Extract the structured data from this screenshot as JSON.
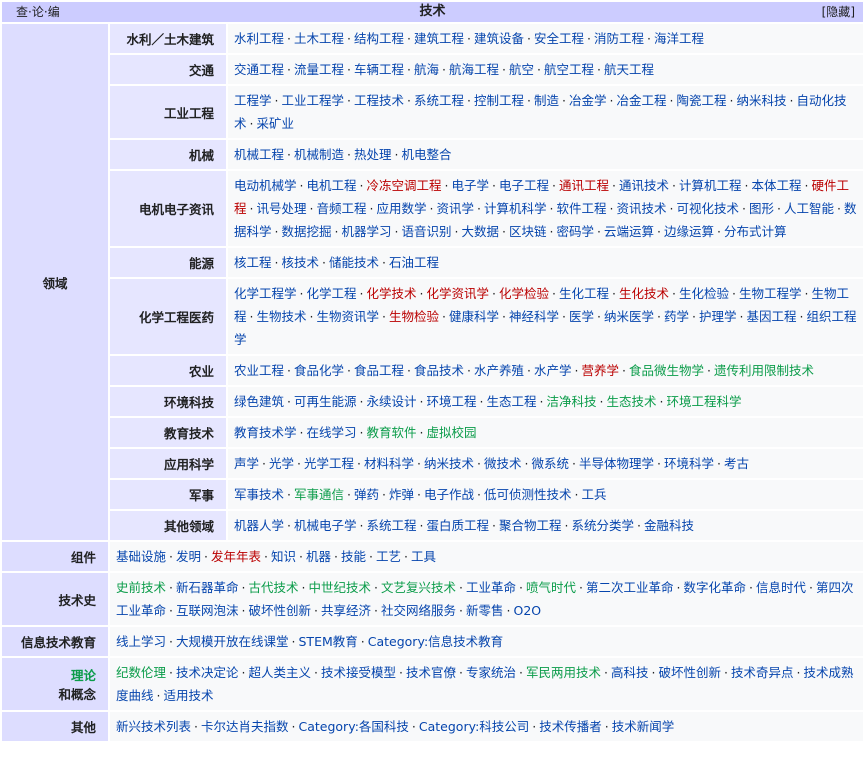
{
  "header": {
    "title": "技术",
    "vte": [
      "查",
      "论",
      "编"
    ],
    "hide": "隐藏"
  },
  "domains": {
    "label": "领域",
    "rows": [
      {
        "label": "水利／土木建筑",
        "items": [
          {
            "t": "水利工程"
          },
          {
            "t": "土木工程"
          },
          {
            "t": "结构工程"
          },
          {
            "t": "建筑工程"
          },
          {
            "t": "建筑设备"
          },
          {
            "t": "安全工程"
          },
          {
            "t": "消防工程"
          },
          {
            "t": "海洋工程"
          }
        ]
      },
      {
        "label": "交通",
        "items": [
          {
            "t": "交通工程"
          },
          {
            "t": "流量工程"
          },
          {
            "t": "车辆工程"
          },
          {
            "t": "航海"
          },
          {
            "t": "航海工程"
          },
          {
            "t": "航空"
          },
          {
            "t": "航空工程"
          },
          {
            "t": "航天工程"
          }
        ]
      },
      {
        "label": "工业工程",
        "items": [
          {
            "t": "工程学"
          },
          {
            "t": "工业工程学"
          },
          {
            "t": "工程技术"
          },
          {
            "t": "系统工程"
          },
          {
            "t": "控制工程"
          },
          {
            "t": "制造"
          },
          {
            "t": "冶金学"
          },
          {
            "t": "冶金工程"
          },
          {
            "t": "陶瓷工程"
          },
          {
            "t": "纳米科技"
          },
          {
            "t": "自动化技术"
          },
          {
            "t": "采矿业"
          }
        ]
      },
      {
        "label": "机械",
        "items": [
          {
            "t": "机械工程"
          },
          {
            "t": "机械制造"
          },
          {
            "t": "热处理"
          },
          {
            "t": "机电整合"
          }
        ]
      },
      {
        "label": "电机电子资讯",
        "items": [
          {
            "t": "电动机械学"
          },
          {
            "t": "电机工程"
          },
          {
            "t": "冷冻空调工程",
            "c": "red"
          },
          {
            "t": "电子学"
          },
          {
            "t": "电子工程"
          },
          {
            "t": "通讯工程",
            "c": "red"
          },
          {
            "t": "通讯技术"
          },
          {
            "t": "计算机工程"
          },
          {
            "t": "本体工程"
          },
          {
            "t": "硬件工程",
            "c": "red"
          },
          {
            "t": "讯号处理"
          },
          {
            "t": "音频工程"
          },
          {
            "t": "应用数学"
          },
          {
            "t": "资讯学"
          },
          {
            "t": "计算机科学"
          },
          {
            "t": "软件工程"
          },
          {
            "t": "资讯技术"
          },
          {
            "t": "可视化技术"
          },
          {
            "t": "图形"
          },
          {
            "t": "人工智能"
          },
          {
            "t": "数据科学"
          },
          {
            "t": "数据挖掘"
          },
          {
            "t": "机器学习"
          },
          {
            "t": "语音识别"
          },
          {
            "t": "大数据"
          },
          {
            "t": "区块链"
          },
          {
            "t": "密码学"
          },
          {
            "t": "云端运算"
          },
          {
            "t": "边缘运算"
          },
          {
            "t": "分布式计算"
          }
        ]
      },
      {
        "label": "能源",
        "items": [
          {
            "t": "核工程"
          },
          {
            "t": "核技术"
          },
          {
            "t": "储能技术"
          },
          {
            "t": "石油工程"
          }
        ]
      },
      {
        "label": "化学工程医药",
        "items": [
          {
            "t": "化学工程学"
          },
          {
            "t": "化学工程"
          },
          {
            "t": "化学技术",
            "c": "red"
          },
          {
            "t": "化学资讯学",
            "c": "red"
          },
          {
            "t": "化学检验",
            "c": "red"
          },
          {
            "t": "生化工程"
          },
          {
            "t": "生化技术",
            "c": "red"
          },
          {
            "t": "生化检验"
          },
          {
            "t": "生物工程学"
          },
          {
            "t": "生物工程"
          },
          {
            "t": "生物技术"
          },
          {
            "t": "生物资讯学"
          },
          {
            "t": "生物检验",
            "c": "red"
          },
          {
            "t": "健康科学"
          },
          {
            "t": "神经科学"
          },
          {
            "t": "医学"
          },
          {
            "t": "纳米医学"
          },
          {
            "t": "药学"
          },
          {
            "t": "护理学"
          },
          {
            "t": "基因工程"
          },
          {
            "t": "组织工程学"
          }
        ]
      },
      {
        "label": "农业",
        "items": [
          {
            "t": "农业工程"
          },
          {
            "t": "食品化学"
          },
          {
            "t": "食品工程"
          },
          {
            "t": "食品技术"
          },
          {
            "t": "水产养殖"
          },
          {
            "t": "水产学"
          },
          {
            "t": "营养学",
            "c": "red"
          },
          {
            "t": "食品微生物学",
            "c": "green"
          },
          {
            "t": "遗传利用限制技术",
            "c": "green"
          }
        ]
      },
      {
        "label": "环境科技",
        "items": [
          {
            "t": "绿色建筑"
          },
          {
            "t": "可再生能源"
          },
          {
            "t": "永续设计"
          },
          {
            "t": "环境工程"
          },
          {
            "t": "生态工程"
          },
          {
            "t": "洁净科技",
            "c": "green"
          },
          {
            "t": "生态技术",
            "c": "green"
          },
          {
            "t": "环境工程科学",
            "c": "green"
          }
        ]
      },
      {
        "label": "教育技术",
        "items": [
          {
            "t": "教育技术学"
          },
          {
            "t": "在线学习"
          },
          {
            "t": "教育软件",
            "c": "green"
          },
          {
            "t": "虚拟校园",
            "c": "green"
          }
        ]
      },
      {
        "label": "应用科学",
        "items": [
          {
            "t": "声学"
          },
          {
            "t": "光学"
          },
          {
            "t": "光学工程"
          },
          {
            "t": "材料科学"
          },
          {
            "t": "纳米技术"
          },
          {
            "t": "微技术"
          },
          {
            "t": "微系统"
          },
          {
            "t": "半导体物理学"
          },
          {
            "t": "环境科学"
          },
          {
            "t": "考古"
          }
        ]
      },
      {
        "label": "军事",
        "items": [
          {
            "t": "军事技术"
          },
          {
            "t": "军事通信",
            "c": "green"
          },
          {
            "t": "弹药"
          },
          {
            "t": "炸弹"
          },
          {
            "t": "电子作战"
          },
          {
            "t": "低可侦测性技术"
          },
          {
            "t": "工兵"
          }
        ]
      },
      {
        "label": "其他领域",
        "items": [
          {
            "t": "机器人学"
          },
          {
            "t": "机械电子学"
          },
          {
            "t": "系统工程"
          },
          {
            "t": "蛋白质工程"
          },
          {
            "t": "聚合物工程"
          },
          {
            "t": "系统分类学"
          },
          {
            "t": "金融科技"
          }
        ]
      }
    ]
  },
  "components": {
    "label": "组件",
    "items": [
      {
        "t": "基础设施"
      },
      {
        "t": "发明"
      },
      {
        "t": "发年年表",
        "c": "red"
      },
      {
        "t": "知识"
      },
      {
        "t": "机器"
      },
      {
        "t": "技能"
      },
      {
        "t": "工艺"
      },
      {
        "t": "工具"
      }
    ]
  },
  "history": {
    "label": "技术史",
    "items": [
      {
        "t": "史前技术",
        "c": "green"
      },
      {
        "t": "新石器革命"
      },
      {
        "t": "古代技术",
        "c": "green"
      },
      {
        "t": "中世纪技术",
        "c": "green"
      },
      {
        "t": "文艺复兴技术",
        "c": "green"
      },
      {
        "t": "工业革命"
      },
      {
        "t": "喷气时代",
        "c": "green"
      },
      {
        "t": "第二次工业革命"
      },
      {
        "t": "数字化革命"
      },
      {
        "t": "信息时代"
      },
      {
        "t": "第四次工业革命"
      },
      {
        "t": "互联网泡沫"
      },
      {
        "t": "破坏性创新"
      },
      {
        "t": "共享经济"
      },
      {
        "t": "社交网络服务"
      },
      {
        "t": "新零售"
      },
      {
        "t": "O2O"
      }
    ]
  },
  "edu": {
    "label": "信息技术教育",
    "items": [
      {
        "t": "线上学习"
      },
      {
        "t": "大规模开放在线课堂"
      },
      {
        "t": "STEM教育"
      },
      {
        "t": "Category:信息技术教育"
      }
    ]
  },
  "theory": {
    "label1": "理论",
    "label2": "和概念",
    "items": [
      {
        "t": "纪数伦理",
        "c": "green"
      },
      {
        "t": "技术决定论"
      },
      {
        "t": "超人类主义"
      },
      {
        "t": "技术接受模型"
      },
      {
        "t": "技术官僚"
      },
      {
        "t": "专家统治"
      },
      {
        "t": "军民两用技术",
        "c": "green"
      },
      {
        "t": "高科技"
      },
      {
        "t": "破坏性创新"
      },
      {
        "t": "技术奇异点"
      },
      {
        "t": "技术成熟度曲线"
      },
      {
        "t": "适用技术"
      }
    ]
  },
  "other": {
    "label": "其他",
    "items": [
      {
        "t": "新兴技术列表"
      },
      {
        "t": "卡尔达肖夫指数"
      },
      {
        "t": "Category:各国科技"
      },
      {
        "t": "Category:科技公司"
      },
      {
        "t": "技术传播者"
      },
      {
        "t": "技术新闻学"
      }
    ]
  }
}
